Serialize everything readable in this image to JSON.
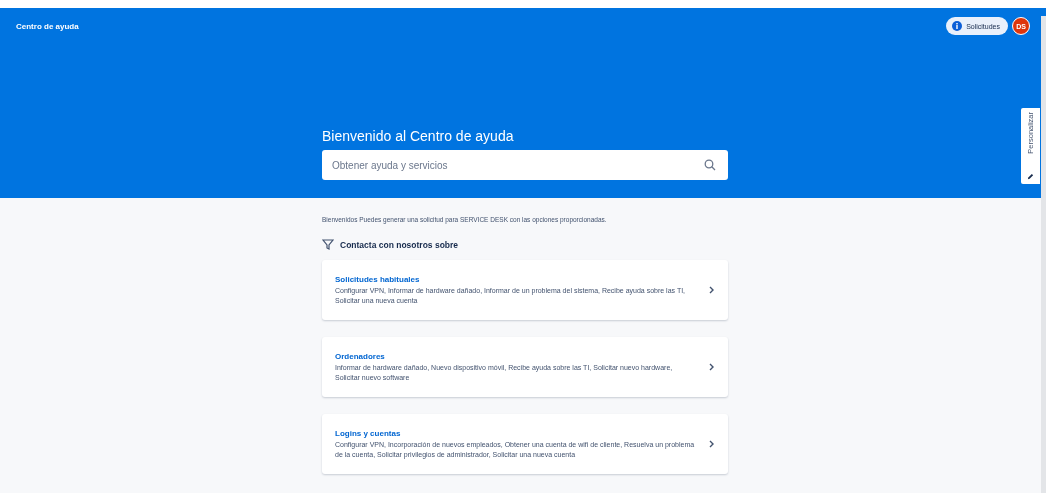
{
  "header": {
    "title": "Centro de ayuda",
    "requests_button": {
      "label": "Solicitudes"
    },
    "avatar": {
      "initials": "DS"
    }
  },
  "hero": {
    "heading": "Bienvenido al Centro de ayuda",
    "search": {
      "placeholder": "Obtener ayuda y servicios"
    }
  },
  "customize_tab": {
    "label": "Personalizar"
  },
  "intro": "Bienvenidos Puedes generar una solicitud para SERVICE DESK con las opciones proporcionadas.",
  "section_title": "Contacta con nosotros sobre",
  "categories": [
    {
      "title": "Solicitudes habituales",
      "description": "Configurar VPN, Informar de hardware dañado, Informar de un problema del sistema, Recibe ayuda sobre las TI, Solicitar una nueva cuenta"
    },
    {
      "title": "Ordenadores",
      "description": "Informar de hardware dañado, Nuevo dispositivo móvil, Recibe ayuda sobre las TI, Solicitar nuevo hardware, Solicitar nuevo software"
    },
    {
      "title": "Logins y cuentas",
      "description": "Configurar VPN, Incorporación de nuevos empleados, Obtener una cuenta de wifi de cliente, Resuelva un problema de la cuenta, Solicitar privilegios de administrador, Solicitar una nueva cuenta"
    }
  ]
}
